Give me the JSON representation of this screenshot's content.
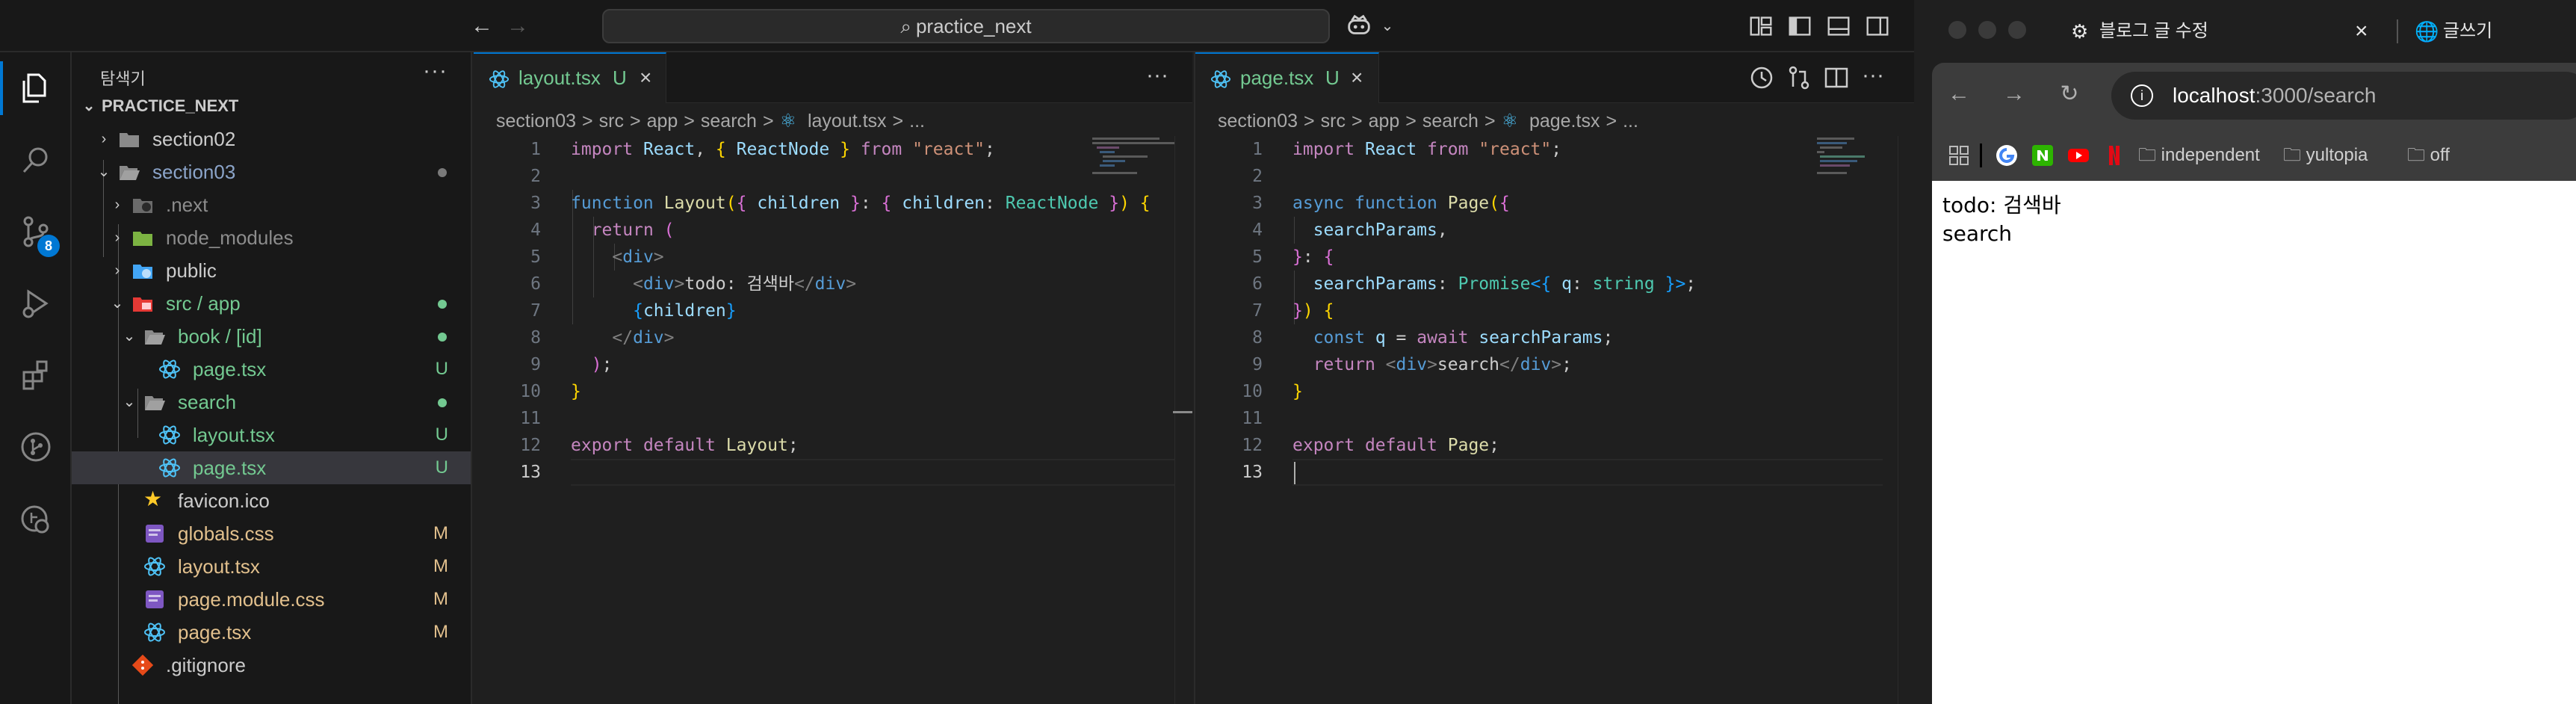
{
  "vscode": {
    "title": "practice_next",
    "sidebar": {
      "header": "탐색기",
      "more": "···",
      "items": [
        {
          "label": "PRACTICE_NEXT",
          "status": ""
        },
        {
          "label": "section02",
          "status": ""
        },
        {
          "label": "section03",
          "status": "•"
        },
        {
          "label": ".next",
          "status": ""
        },
        {
          "label": "node_modules",
          "status": ""
        },
        {
          "label": "public",
          "status": ""
        },
        {
          "label": "src / app",
          "status": "•"
        },
        {
          "label": "book / [id]",
          "status": "•"
        },
        {
          "label": "page.tsx",
          "status": "U"
        },
        {
          "label": "search",
          "status": "•"
        },
        {
          "label": "layout.tsx",
          "status": "U"
        },
        {
          "label": "page.tsx",
          "status": "U"
        },
        {
          "label": "favicon.ico",
          "status": ""
        },
        {
          "label": "globals.css",
          "status": "M"
        },
        {
          "label": "layout.tsx",
          "status": "M"
        },
        {
          "label": "page.module.css",
          "status": "M"
        },
        {
          "label": "page.tsx",
          "status": "M"
        },
        {
          "label": ".gitignore",
          "status": ""
        }
      ],
      "source_control_badge": "8"
    },
    "left_editor": {
      "tab_label": "layout.tsx",
      "tab_status": "U",
      "more": "···",
      "breadcrumbs": [
        "section03",
        ">",
        "src",
        ">",
        "app",
        ">",
        "search",
        ">",
        "layout.tsx",
        ">",
        "..."
      ],
      "line_numbers": [
        "1",
        "2",
        "3",
        "4",
        "5",
        "6",
        "7",
        "8",
        "9",
        "10",
        "11",
        "12",
        "13"
      ]
    },
    "right_editor": {
      "tab_label": "page.tsx",
      "tab_status": "U",
      "breadcrumbs": [
        "section03",
        ">",
        "src",
        ">",
        "app",
        ">",
        "search",
        ">",
        "page.tsx",
        ">",
        "..."
      ],
      "line_numbers": [
        "1",
        "2",
        "3",
        "4",
        "5",
        "6",
        "7",
        "8",
        "9",
        "10",
        "11",
        "12",
        "13"
      ]
    }
  },
  "browser": {
    "tabs": [
      {
        "label": "블로그 글 수정"
      },
      {
        "label": "글쓰기"
      }
    ],
    "url_host": "localhost",
    "url_path": ":3000/search",
    "bookmarks": [
      "independent",
      "yultopia",
      "off"
    ],
    "page": {
      "line1": "todo: 검색바",
      "line2": "search"
    }
  },
  "colors": {
    "accent": "#0078d4",
    "untracked": "#73c991",
    "modified": "#e2c08d",
    "editor_bg": "#1f1f1f",
    "sidebar_bg": "#181818"
  }
}
